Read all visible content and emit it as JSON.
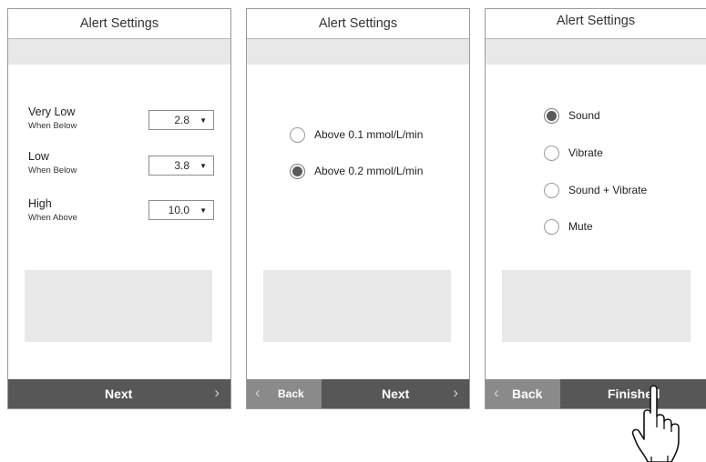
{
  "screens": [
    {
      "title": "Alert Settings",
      "thresholds": [
        {
          "label": "Very Low",
          "sub": "When Below",
          "value": "2.8"
        },
        {
          "label": "Low",
          "sub": "When Below",
          "value": "3.8"
        },
        {
          "label": "High",
          "sub": "When Above",
          "value": "10.0"
        }
      ],
      "next_label": "Next"
    },
    {
      "title": "Alert Settings",
      "options": [
        {
          "label": "Above 0.1 mmol/L/min",
          "selected": false
        },
        {
          "label": "Above 0.2 mmol/L/min",
          "selected": true
        }
      ],
      "back_label": "Back",
      "next_label": "Next"
    },
    {
      "title": "Alert Settings",
      "options": [
        {
          "label": "Sound",
          "selected": true
        },
        {
          "label": "Vibrate",
          "selected": false
        },
        {
          "label": "Sound + Vibrate",
          "selected": false
        },
        {
          "label": "Mute",
          "selected": false
        }
      ],
      "back_label": "Back",
      "finish_label": "Finished"
    }
  ],
  "icons": {
    "chevron_left": "chevron-left-icon",
    "chevron_right": "chevron-right-icon",
    "dropdown": "triangle-down-icon",
    "hand_cursor": "pointing-hand-icon"
  },
  "colors": {
    "footer": "#575757",
    "back_button": "#8a8a8a",
    "panel": "#e8e8e8",
    "radio_fill": "#5a5a5a"
  }
}
